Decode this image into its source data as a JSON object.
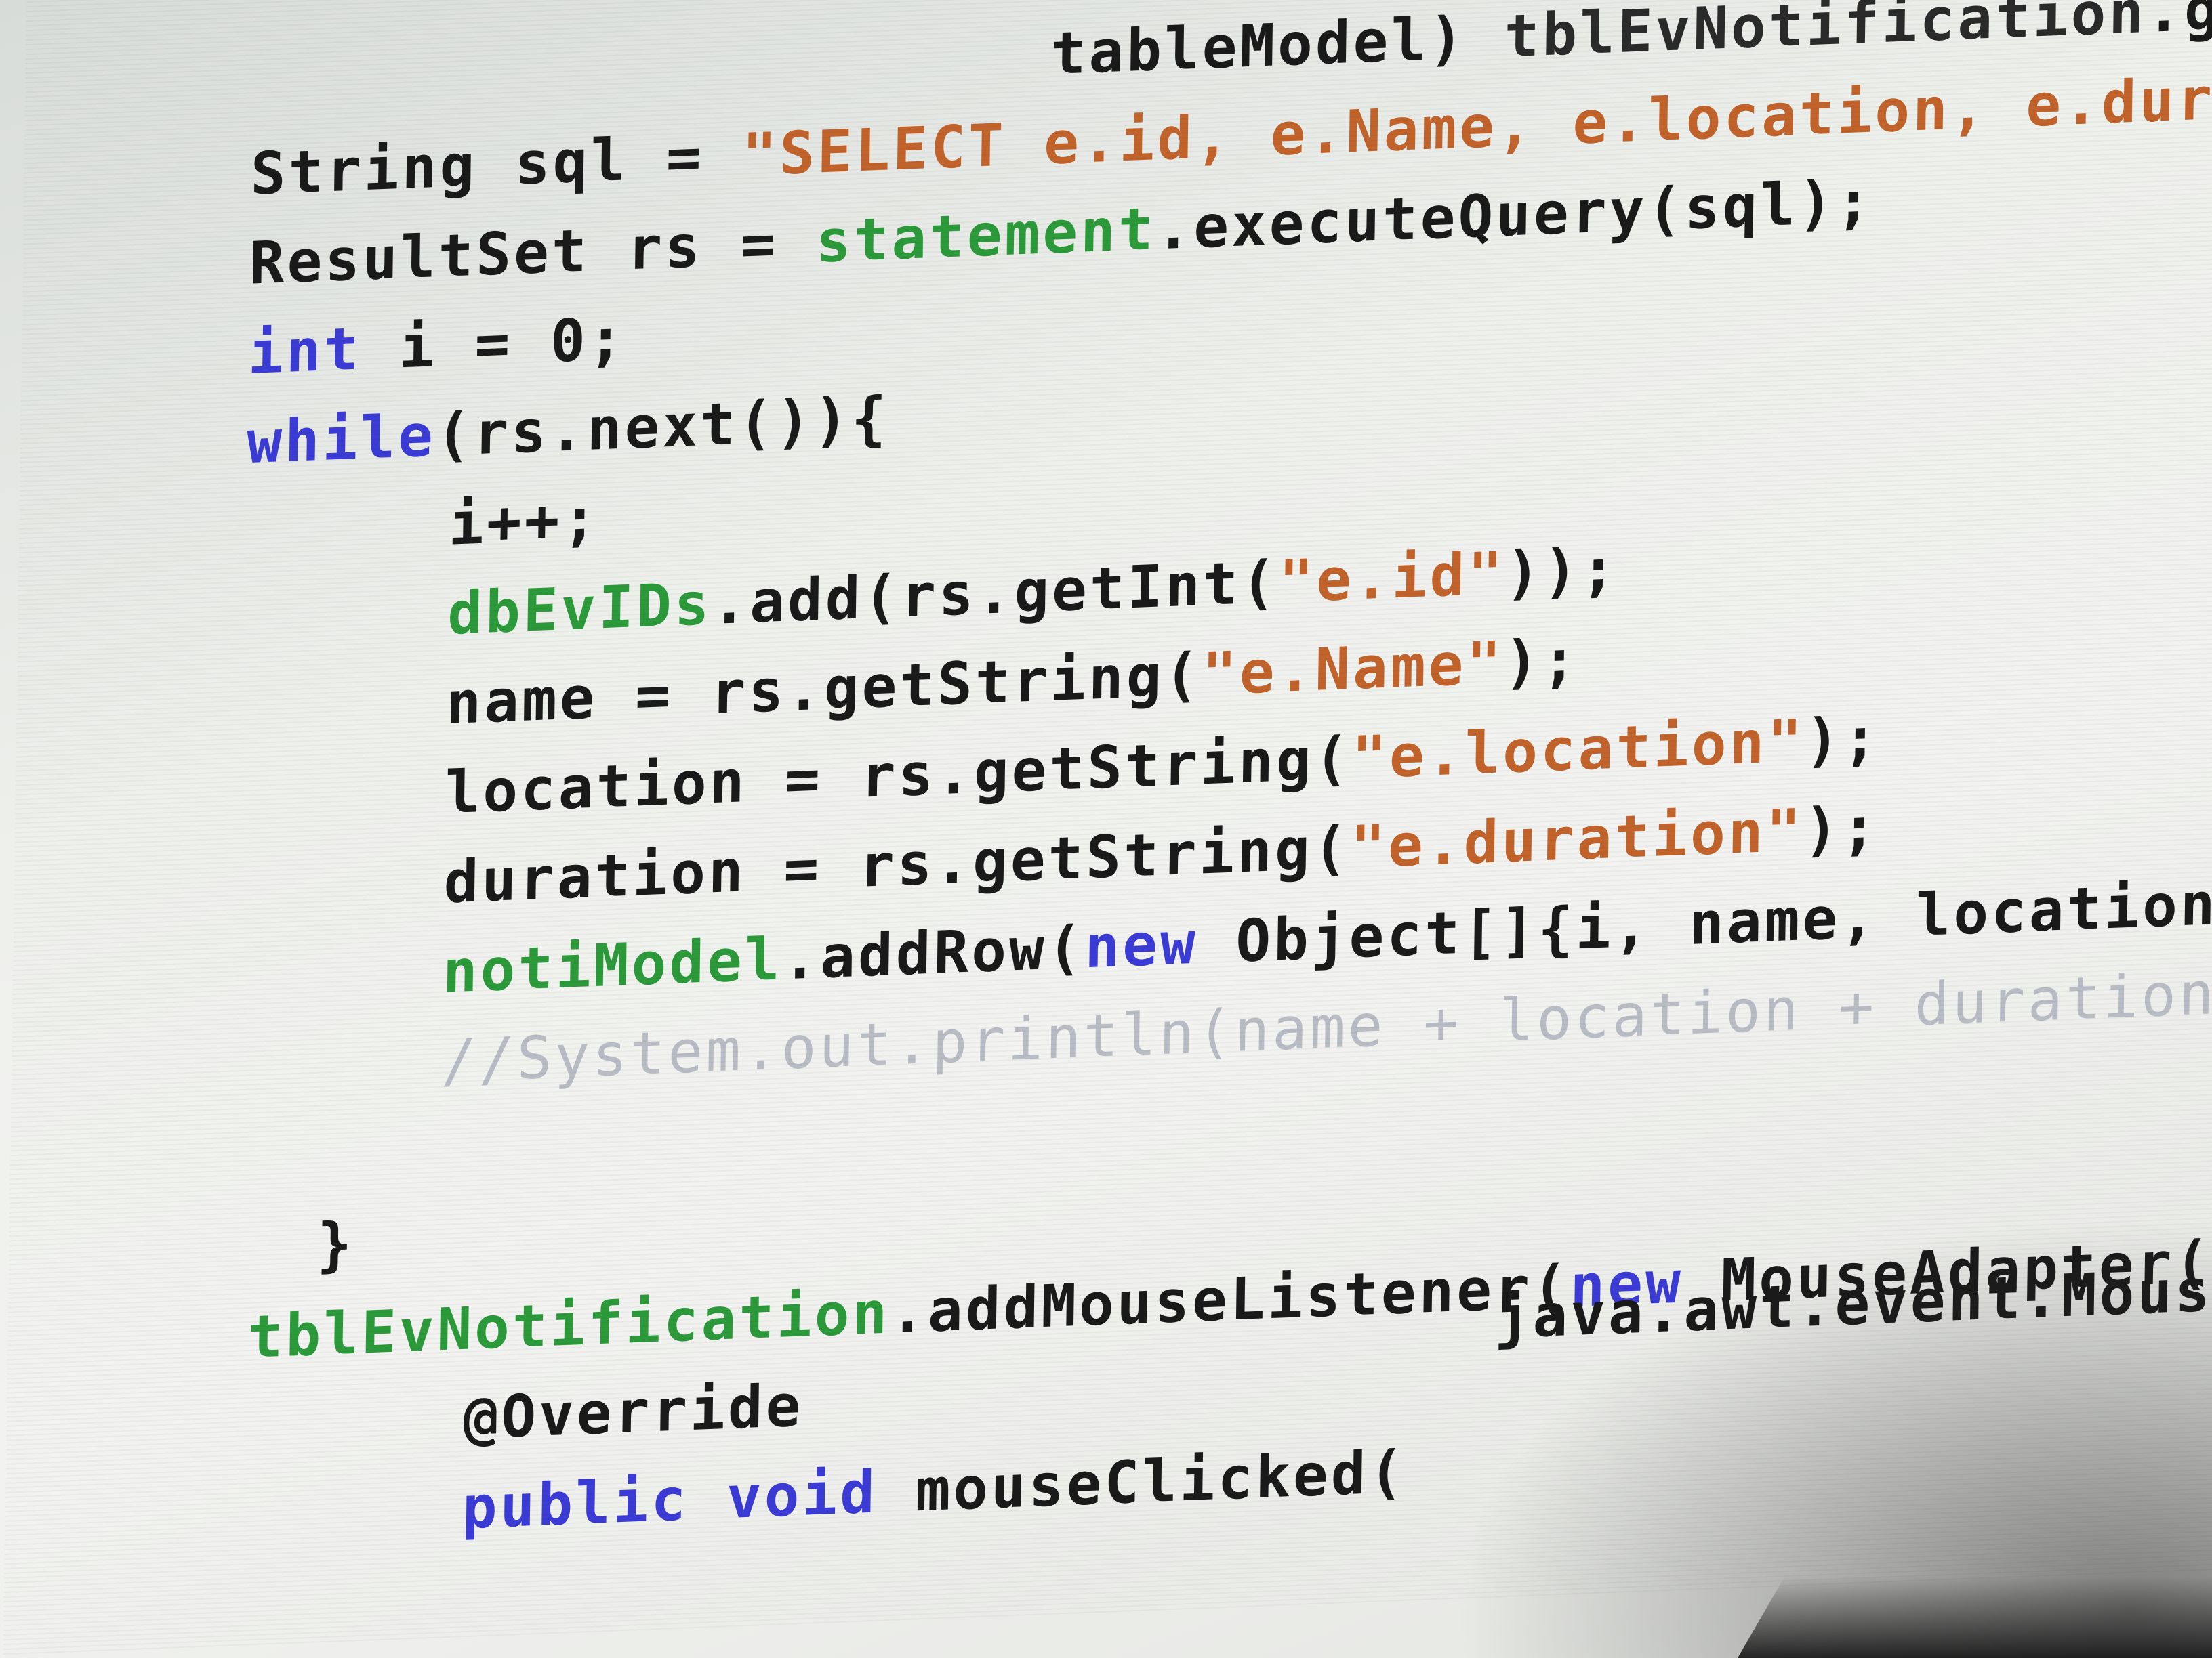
{
  "editor": {
    "language": "Java",
    "colors": {
      "keyword": "#3b3bd6",
      "field": "#2c9a3a",
      "string": "#c1632b",
      "comment": "#b8bcc4",
      "text": "#1a1a1a"
    },
    "lines": {
      "l0": {
        "a": "tableModel) ",
        "b": "tblEvNotification",
        "c": ".getModel();"
      },
      "l1": {
        "a": "String sql = ",
        "b": "\"SELECT e.id, e.Name, e.location, e.duration FROM i"
      },
      "l2": {
        "a": "ResultSet rs = ",
        "b": "statement",
        "c": ".executeQuery(sql);"
      },
      "l3": {
        "kw": "int",
        "a": " i = 0;"
      },
      "l4": {
        "kw": "while",
        "a": "(rs.next()){"
      },
      "l5": {
        "a": "i++;"
      },
      "l6": {
        "f": "dbEvIDs",
        "a": ".add(rs.getInt(",
        "s": "\"e.id\"",
        "b": "));"
      },
      "l7": {
        "a": "name = rs.getString(",
        "s": "\"e.Name\"",
        "b": ");"
      },
      "l8": {
        "a": "location = rs.getString(",
        "s": "\"e.location\"",
        "b": ");"
      },
      "l9": {
        "a": "duration = rs.getString(",
        "s": "\"e.duration\"",
        "b": ");"
      },
      "l10": {
        "f": "notiModel",
        "a": ".addRow(",
        "kw": "new",
        "b": " Object[]{i, name, location, duration}"
      },
      "l11": {
        "cmt": "//System.out.println(name + location + duration);"
      },
      "l13": {
        "a": "}"
      },
      "l14": {
        "f": "tblEvNotification",
        "a": ".addMouseListener(",
        "kw": "new",
        "b": " MouseAdapter() {"
      },
      "l15": {
        "a": "@Override",
        "b": "java.awt.event.MouseEvent evt) {"
      },
      "l16": {
        "kw1": "public",
        "kw2": "void",
        "a": " mouseClicked("
      }
    }
  }
}
